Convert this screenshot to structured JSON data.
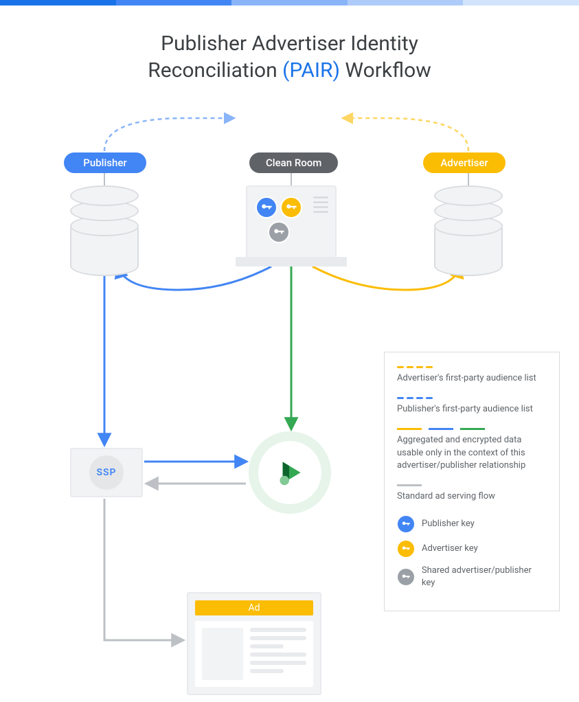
{
  "title": {
    "line1": "Publisher Advertiser Identity",
    "line2_prefix": "Reconciliation ",
    "line2_highlight": "(PAIR)",
    "line2_suffix": " Workflow"
  },
  "nodes": {
    "publisher": "Publisher",
    "cleanroom": "Clean Room",
    "advertiser": "Advertiser",
    "ssp": "SSP",
    "ad": "Ad"
  },
  "legend": {
    "advertiser_list": "Advertiser's first-party audience list",
    "publisher_list": "Publisher's first-party audience list",
    "aggregated": "Aggregated and encrypted data usable only in the context of this advertiser/publisher relationship",
    "standard": "Standard ad serving flow",
    "publisher_key": "Publisher key",
    "advertiser_key": "Advertiser key",
    "shared_key": "Shared advertiser/publisher key"
  },
  "icons": {
    "key": "key-icon",
    "database": "database-icon",
    "server": "server-icon",
    "play": "play-icon"
  },
  "colors": {
    "blue": "#4285f4",
    "orange": "#fbbc04",
    "green": "#34a853",
    "grey": "#9aa0a6",
    "lightgrey": "#bdc1c6"
  }
}
